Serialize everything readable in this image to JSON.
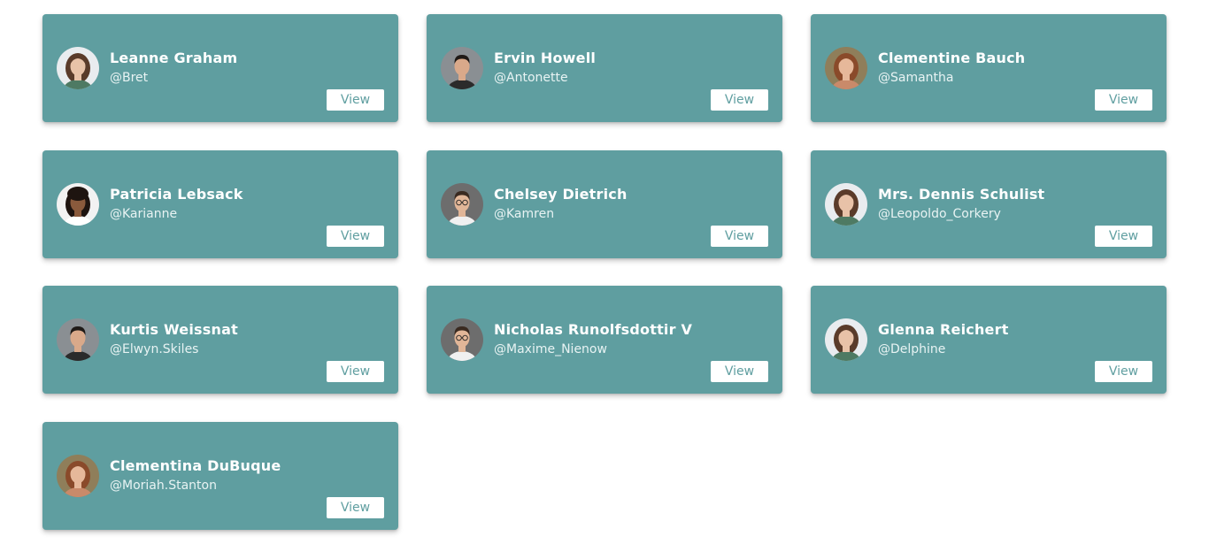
{
  "users": [
    {
      "name": "Leanne Graham",
      "handle": "@Bret",
      "button": "View",
      "avatar": {
        "icon": "avatar-woman-curly-icon",
        "bg": "#e9ecef",
        "hair": "#5a3b2a",
        "skin": "#e8c2a8",
        "shirt": "#4e7a63"
      }
    },
    {
      "name": "Ervin Howell",
      "handle": "@Antonette",
      "button": "View",
      "avatar": {
        "icon": "avatar-man-dark-hair-icon",
        "bg": "#8a8f93",
        "hair": "#1f1a17",
        "skin": "#d9a98a",
        "shirt": "#2b2b2b"
      }
    },
    {
      "name": "Clementine Bauch",
      "handle": "@Samantha",
      "button": "View",
      "avatar": {
        "icon": "avatar-woman-auburn-icon",
        "bg": "#8f7e5a",
        "hair": "#8a4a2a",
        "skin": "#e6b89a",
        "shirt": "#c98a6a"
      }
    },
    {
      "name": "Patricia Lebsack",
      "handle": "@Karianne",
      "button": "View",
      "avatar": {
        "icon": "avatar-woman-afro-icon",
        "bg": "#f2f2f2",
        "hair": "#1e1410",
        "skin": "#8a5a3c",
        "shirt": "#ffffff"
      }
    },
    {
      "name": "Chelsey Dietrich",
      "handle": "@Kamren",
      "button": "View",
      "avatar": {
        "icon": "avatar-man-glasses-icon",
        "bg": "#6d6d6d",
        "hair": "#3a2a20",
        "skin": "#e1b698",
        "shirt": "#f0f0f0"
      }
    },
    {
      "name": "Mrs. Dennis Schulist",
      "handle": "@Leopoldo_Corkery",
      "button": "View",
      "avatar": {
        "icon": "avatar-woman-curly-icon",
        "bg": "#e9ecef",
        "hair": "#5a3b2a",
        "skin": "#e8c2a8",
        "shirt": "#4e7a63"
      }
    },
    {
      "name": "Kurtis Weissnat",
      "handle": "@Elwyn.Skiles",
      "button": "View",
      "avatar": {
        "icon": "avatar-man-dark-hair-icon",
        "bg": "#8a8f93",
        "hair": "#1f1a17",
        "skin": "#d9a98a",
        "shirt": "#2b2b2b"
      }
    },
    {
      "name": "Nicholas Runolfsdottir V",
      "handle": "@Maxime_Nienow",
      "button": "View",
      "avatar": {
        "icon": "avatar-man-glasses-icon",
        "bg": "#6d6d6d",
        "hair": "#3a2a20",
        "skin": "#e1b698",
        "shirt": "#f0f0f0"
      }
    },
    {
      "name": "Glenna Reichert",
      "handle": "@Delphine",
      "button": "View",
      "avatar": {
        "icon": "avatar-woman-curly-icon",
        "bg": "#e9ecef",
        "hair": "#5a3b2a",
        "skin": "#e8c2a8",
        "shirt": "#4e7a63"
      }
    },
    {
      "name": "Clementina DuBuque",
      "handle": "@Moriah.Stanton",
      "button": "View",
      "avatar": {
        "icon": "avatar-woman-auburn-icon",
        "bg": "#8f7e5a",
        "hair": "#8a4a2a",
        "skin": "#e6b89a",
        "shirt": "#c98a6a"
      }
    }
  ],
  "colors": {
    "card_bg": "#5f9ea0",
    "name_text": "#ffffff",
    "button_bg": "#ffffff",
    "button_text": "#5f9ea0"
  }
}
